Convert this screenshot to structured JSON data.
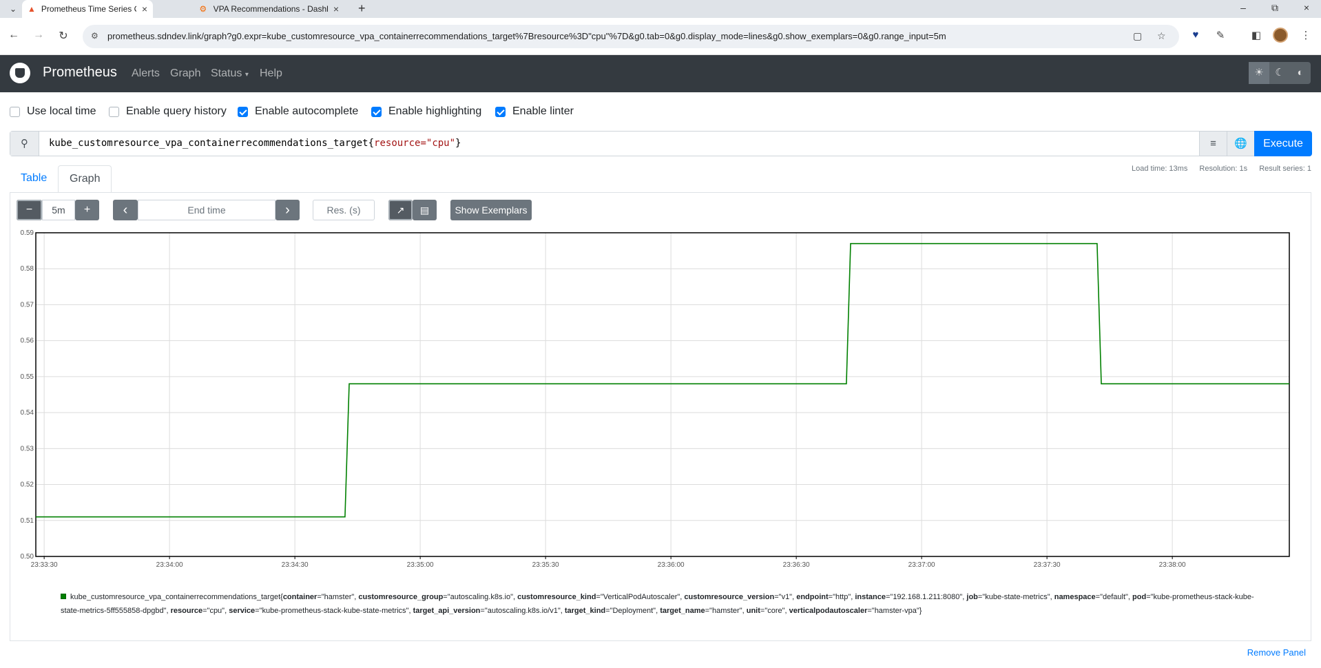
{
  "browser": {
    "tabs": [
      {
        "title": "Prometheus Time Series Collecti",
        "active": true
      },
      {
        "title": "VPA Recommendations - Dashb",
        "active": false
      }
    ],
    "url": "prometheus.sdndev.link/graph?g0.expr=kube_customresource_vpa_containerrecommendations_target%7Bresource%3D\"cpu\"%7D&g0.tab=0&g0.display_mode=lines&g0.show_exemplars=0&g0.range_input=5m"
  },
  "navbar": {
    "brand": "Prometheus",
    "links": [
      "Alerts",
      "Graph",
      "Status",
      "Help"
    ]
  },
  "options": [
    {
      "label": "Use local time",
      "checked": false
    },
    {
      "label": "Enable query history",
      "checked": false
    },
    {
      "label": "Enable autocomplete",
      "checked": true
    },
    {
      "label": "Enable highlighting",
      "checked": true
    },
    {
      "label": "Enable linter",
      "checked": true
    }
  ],
  "expression": {
    "metric": "kube_customresource_vpa_containerrecommendations_target",
    "open_brace": "{",
    "label_matcher": "resource=\"cpu\"",
    "close_brace": "}"
  },
  "execute_label": "Execute",
  "tabs": {
    "table": "Table",
    "graph": "Graph"
  },
  "stats": {
    "load_time": "Load time: 13ms",
    "resolution": "Resolution: 1s",
    "result_series": "Result series: 1"
  },
  "controls": {
    "minus": "−",
    "range": "5m",
    "plus": "+",
    "prev": "‹",
    "end_time_placeholder": "End time",
    "next": "›",
    "res_placeholder": "Res. (s)",
    "show_exemplars": "Show Exemplars"
  },
  "chart_data": {
    "type": "line",
    "ylim": [
      0.5,
      0.59
    ],
    "y_ticks": [
      "0.50",
      "0.51",
      "0.52",
      "0.53",
      "0.54",
      "0.55",
      "0.56",
      "0.57",
      "0.58",
      "0.59"
    ],
    "x_ticks": [
      "23:33:30",
      "23:34:00",
      "23:34:30",
      "23:35:00",
      "23:35:30",
      "23:36:00",
      "23:36:30",
      "23:37:00",
      "23:37:30",
      "23:38:00"
    ],
    "x_range": [
      "23:33:28",
      "23:38:28"
    ],
    "grid": true,
    "series": [
      {
        "color": "#008000",
        "points": [
          [
            "23:33:28",
            0.511
          ],
          [
            "23:34:42",
            0.511
          ],
          [
            "23:34:43",
            0.548
          ],
          [
            "23:36:42",
            0.548
          ],
          [
            "23:36:43",
            0.587
          ],
          [
            "23:37:42",
            0.587
          ],
          [
            "23:37:43",
            0.548
          ],
          [
            "23:38:28",
            0.548
          ]
        ]
      }
    ]
  },
  "legend": {
    "metric": "kube_customresource_vpa_containerrecommendations_target",
    "labels": [
      {
        "k": "container",
        "v": "\"hamster\""
      },
      {
        "k": "customresource_group",
        "v": "\"autoscaling.k8s.io\""
      },
      {
        "k": "customresource_kind",
        "v": "\"VerticalPodAutoscaler\""
      },
      {
        "k": "customresource_version",
        "v": "\"v1\""
      },
      {
        "k": "endpoint",
        "v": "\"http\""
      },
      {
        "k": "instance",
        "v": "\"192.168.1.211:8080\""
      },
      {
        "k": "job",
        "v": "\"kube-state-metrics\""
      },
      {
        "k": "namespace",
        "v": "\"default\""
      },
      {
        "k": "pod",
        "v": "\"kube-prometheus-stack-kube-state-metrics-5ff555858-dpgbd\""
      },
      {
        "k": "resource",
        "v": "\"cpu\""
      },
      {
        "k": "service",
        "v": "\"kube-prometheus-stack-kube-state-metrics\""
      },
      {
        "k": "target_api_version",
        "v": "\"autoscaling.k8s.io/v1\""
      },
      {
        "k": "target_kind",
        "v": "\"Deployment\""
      },
      {
        "k": "target_name",
        "v": "\"hamster\""
      },
      {
        "k": "unit",
        "v": "\"core\""
      },
      {
        "k": "verticalpodautoscaler",
        "v": "\"hamster-vpa\""
      }
    ]
  },
  "remove_panel": "Remove Panel"
}
